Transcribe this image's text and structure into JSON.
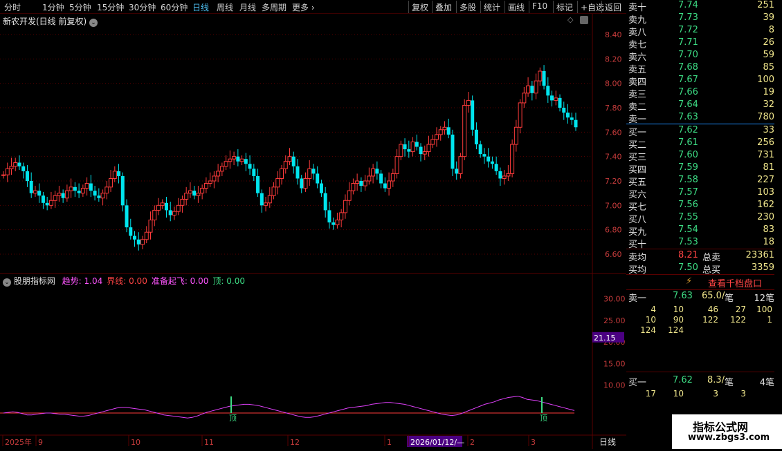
{
  "toolbar": {
    "left_tabs": [
      "分时",
      "1分钟",
      "5分钟",
      "15分钟",
      "30分钟",
      "60分钟",
      "日线",
      "周线",
      "月线",
      "多周期",
      "更多"
    ],
    "active_tab": "日线",
    "right_tabs": [
      "复权",
      "叠加",
      "多股",
      "统计",
      "画线",
      "F10",
      "标记",
      "+自选",
      "返回"
    ]
  },
  "stock": {
    "title": "新农开发(日线 前复权)"
  },
  "price_axis": [
    "8.40",
    "8.20",
    "8.00",
    "7.80",
    "7.60",
    "7.40",
    "7.20",
    "7.00",
    "6.80",
    "6.60"
  ],
  "indicator": {
    "name": "股朋指标网",
    "items": [
      {
        "label": "趋势:",
        "value": "1.04",
        "color": "#ff55ff"
      },
      {
        "label": "界线:",
        "value": "0.00",
        "color": "#ff4444"
      },
      {
        "label": "准备起飞:",
        "value": "0.00",
        "color": "#ff55ff"
      },
      {
        "label": "顶:",
        "value": "0.00",
        "color": "#3ddc84"
      }
    ],
    "axis": [
      "30.00",
      "25.00",
      "20.00",
      "15.00",
      "10.00"
    ],
    "marker_value": "21.15",
    "top_label": "顶"
  },
  "time_axis": [
    "2025年",
    "9",
    "10",
    "11",
    "12",
    "1",
    "2026/01/12/—",
    "2",
    "3"
  ],
  "period_label": "日线",
  "order_book": {
    "asks": [
      {
        "label": "卖十",
        "price": "7.74",
        "vol": "251"
      },
      {
        "label": "卖九",
        "price": "7.73",
        "vol": "39"
      },
      {
        "label": "卖八",
        "price": "7.72",
        "vol": "8"
      },
      {
        "label": "卖七",
        "price": "7.71",
        "vol": "26"
      },
      {
        "label": "卖六",
        "price": "7.70",
        "vol": "59"
      },
      {
        "label": "卖五",
        "price": "7.68",
        "vol": "85"
      },
      {
        "label": "卖四",
        "price": "7.67",
        "vol": "100"
      },
      {
        "label": "卖三",
        "price": "7.66",
        "vol": "19"
      },
      {
        "label": "卖二",
        "price": "7.64",
        "vol": "32"
      },
      {
        "label": "卖一",
        "price": "7.63",
        "vol": "780"
      }
    ],
    "bids": [
      {
        "label": "买一",
        "price": "7.62",
        "vol": "33"
      },
      {
        "label": "买二",
        "price": "7.61",
        "vol": "256"
      },
      {
        "label": "买三",
        "price": "7.60",
        "vol": "731"
      },
      {
        "label": "买四",
        "price": "7.59",
        "vol": "81"
      },
      {
        "label": "买五",
        "price": "7.58",
        "vol": "227"
      },
      {
        "label": "买六",
        "price": "7.57",
        "vol": "103"
      },
      {
        "label": "买七",
        "price": "7.56",
        "vol": "162"
      },
      {
        "label": "买八",
        "price": "7.55",
        "vol": "230"
      },
      {
        "label": "买九",
        "price": "7.54",
        "vol": "83"
      },
      {
        "label": "买十",
        "price": "7.53",
        "vol": "18"
      }
    ],
    "sell_avg_label": "卖均",
    "sell_avg": "8.21",
    "total_sell_label": "总卖",
    "total_sell": "23361",
    "buy_avg_label": "买均",
    "buy_avg": "7.50",
    "total_buy_label": "总买",
    "total_buy": "3359",
    "thousand_btn": "查看千档盘口",
    "ask1": {
      "label": "卖一",
      "price": "7.63",
      "avg": "65.0/",
      "unit": "笔",
      "count": "12笔",
      "rows": [
        [
          "4",
          "10",
          "46",
          "27",
          "100"
        ],
        [
          "10",
          "90",
          "122",
          "122",
          "1"
        ],
        [
          "124",
          "124"
        ]
      ]
    },
    "bid1": {
      "label": "买一",
      "price": "7.62",
      "avg": "8.3/",
      "unit": "笔",
      "count": "4笔",
      "rows": [
        [
          "17",
          "10",
          "3",
          "3"
        ]
      ]
    }
  },
  "watermark": {
    "line1": "指标公式网",
    "line2": "www.zbgs3.com"
  },
  "colors": {
    "up": "#ff3b3b",
    "down": "#00e5ee",
    "grid": "#5a0000",
    "indicator_line": "#e040fb"
  }
}
